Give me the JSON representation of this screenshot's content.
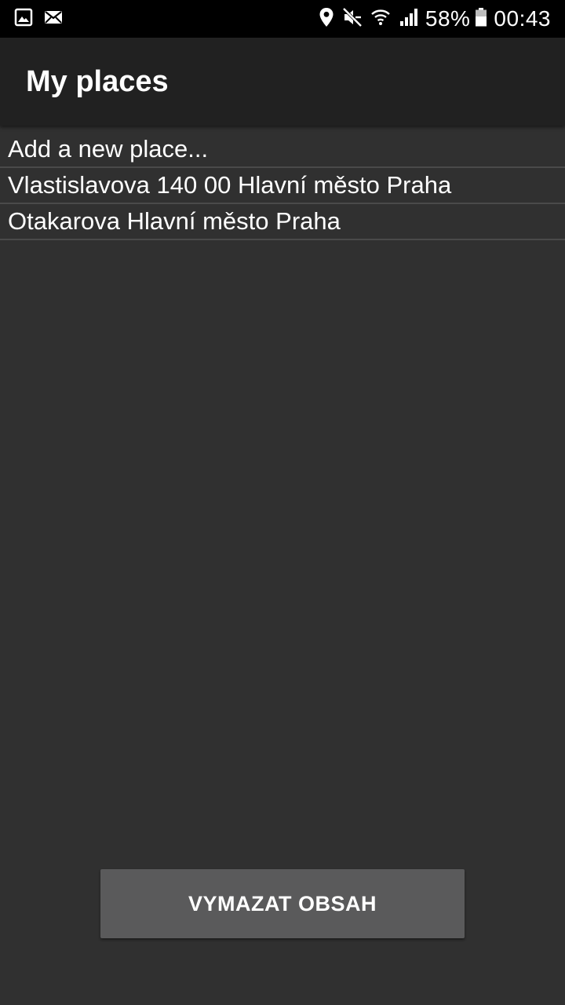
{
  "status_bar": {
    "icons_left": [
      "gallery-icon",
      "mail-icon"
    ],
    "icons_right": [
      "location-icon",
      "mute-icon",
      "wifi-icon",
      "signal-icon"
    ],
    "battery_text": "58%",
    "time": "00:43"
  },
  "app_bar": {
    "title": "My places"
  },
  "places": {
    "items": [
      {
        "label": "Add a new place..."
      },
      {
        "label": "Vlastislavova 140 00 Hlavní město Praha"
      },
      {
        "label": "Otakarova Hlavní město Praha"
      }
    ]
  },
  "actions": {
    "clear_label": "VYMAZAT OBSAH"
  },
  "colors": {
    "background": "#303030",
    "app_bar": "#212121",
    "status_bar": "#000000",
    "button": "#5a5a5b",
    "divider": "#4a4a4a"
  }
}
